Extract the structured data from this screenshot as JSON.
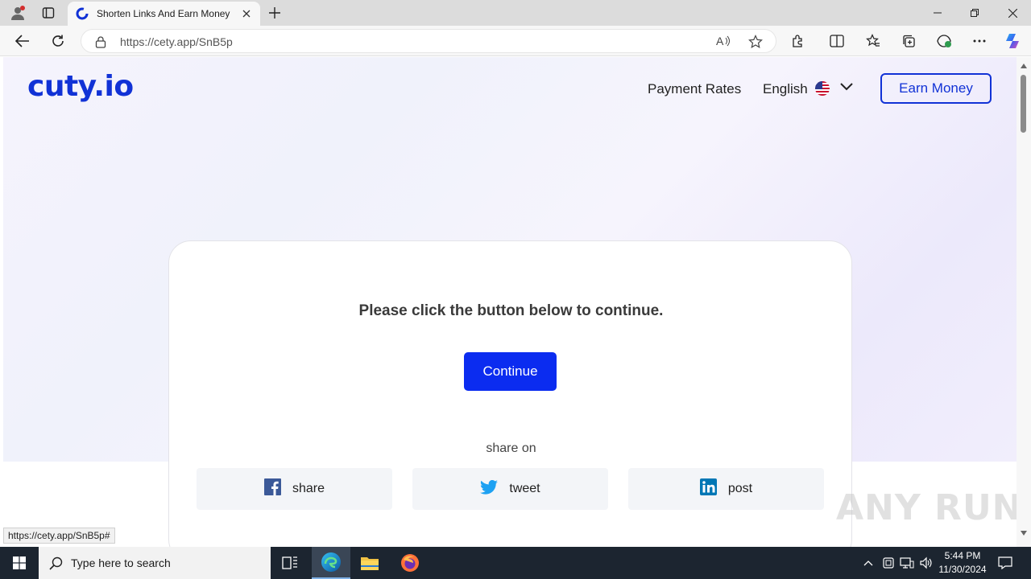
{
  "browser": {
    "tab_title": "Shorten Links And Earn Money |",
    "url": "https://cety.app/SnB5p",
    "status_url": "https://cety.app/SnB5p#"
  },
  "site": {
    "logo": "cuty.io",
    "nav": {
      "payment_rates": "Payment Rates",
      "language": "English",
      "earn_money": "Earn Money"
    },
    "card": {
      "message": "Please click the button below to continue.",
      "continue_label": "Continue",
      "share_on": "share on",
      "share_buttons": [
        {
          "label": "share",
          "icon": "facebook-icon"
        },
        {
          "label": "tweet",
          "icon": "twitter-icon"
        },
        {
          "label": "post",
          "icon": "linkedin-icon"
        }
      ]
    },
    "colors": {
      "brand": "#1132d6",
      "continue_button": "#0b2cf0"
    }
  },
  "watermark": "ANY RUN",
  "taskbar": {
    "search_placeholder": "Type here to search",
    "time": "5:44 PM",
    "date": "11/30/2024"
  }
}
